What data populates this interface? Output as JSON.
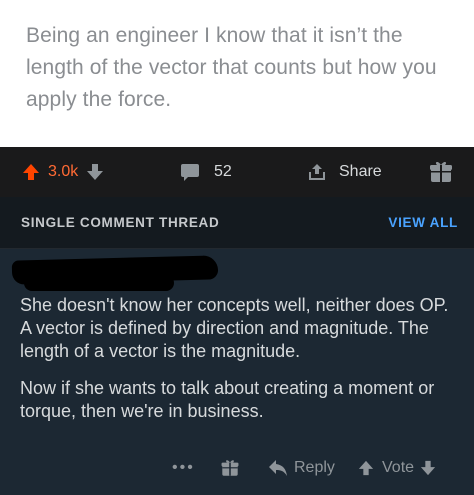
{
  "post": {
    "text": "Being an engineer I know that it isn’t the length of the vector that counts but how you apply the force."
  },
  "actions": {
    "upvote_count": "3.0k",
    "comment_count": "52",
    "share_label": "Share"
  },
  "thread": {
    "title": "SINGLE COMMENT THREAD",
    "view_all_label": "VIEW ALL"
  },
  "comment": {
    "paragraphs": [
      "She doesn't know her concepts well, neither does OP. A vector is defined by direction and magnitude. The length of a vector is the magnitude.",
      "Now if she wants to talk about creating a moment or torque, then we're in business."
    ],
    "more_label": "•••",
    "reply_label": "Reply",
    "vote_label": "Vote"
  },
  "colors": {
    "upvote_active": "#ff6a34",
    "link_blue": "#4aa3ff",
    "comment_bg": "#1c2833"
  },
  "icons": [
    "upvote-arrow-icon",
    "downvote-arrow-icon",
    "comment-bubble-icon",
    "share-icon",
    "award-gift-icon",
    "reply-arrow-icon"
  ]
}
